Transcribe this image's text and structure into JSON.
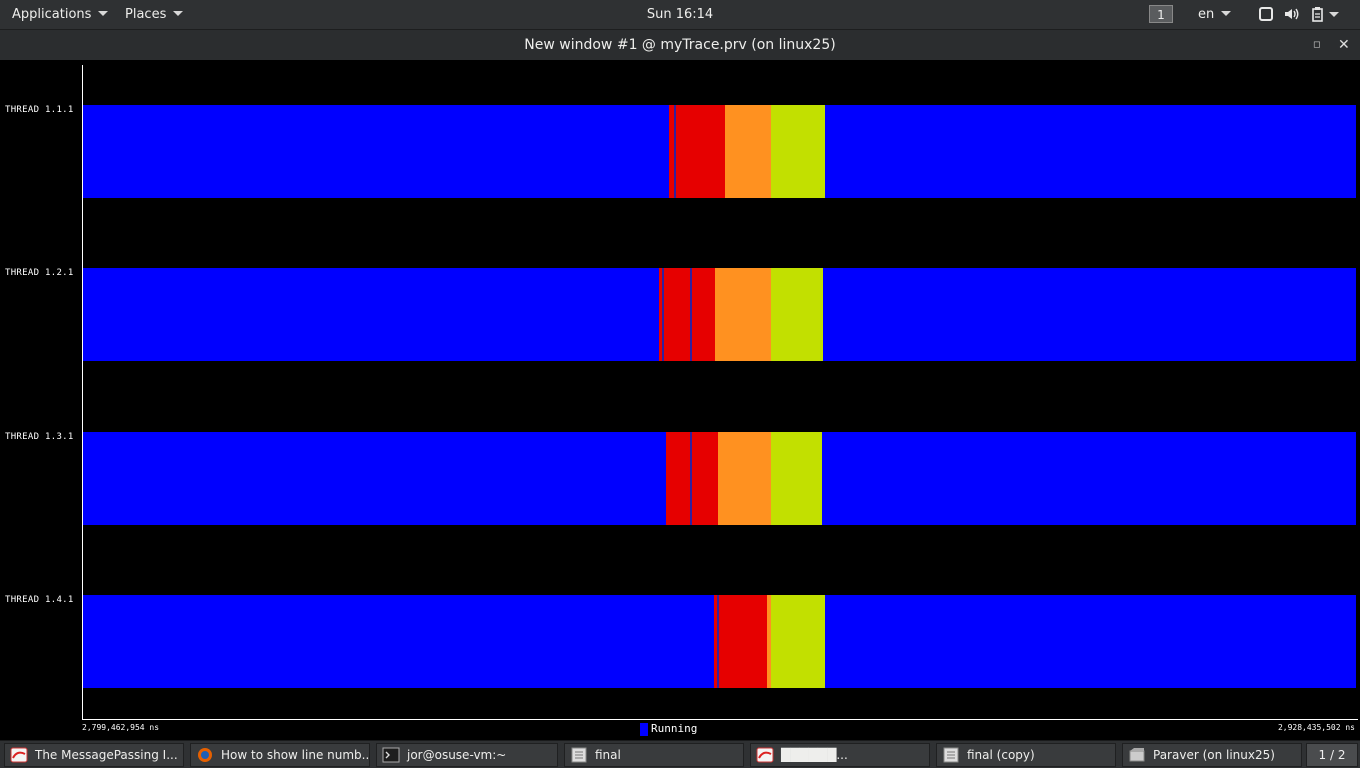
{
  "top_panel": {
    "applications_label": "Applications",
    "places_label": "Places",
    "clock": "Sun 16:14",
    "workspace_number": "1",
    "language": "en"
  },
  "window": {
    "title": "New window #1 @ myTrace.prv (on linux25)"
  },
  "timeline": {
    "threads": [
      "THREAD 1.1.1",
      "THREAD 1.2.1",
      "THREAD 1.3.1",
      "THREAD 1.4.1"
    ],
    "start_time": "2,799,462,954 ns",
    "end_time": "2,928,435,502 ns",
    "legend_label": "Running",
    "legend_color": "#0000ff",
    "state_colors": {
      "running": "#0000ff",
      "red": "#e60000",
      "orange": "#ff9120",
      "yellow_green": "#c2e000"
    }
  },
  "taskbar": {
    "tasks": [
      {
        "label": "The MessagePassing I...",
        "icon": "paraver-icon"
      },
      {
        "label": "How to show line numb...",
        "icon": "firefox-icon"
      },
      {
        "label": "jor@osuse-vm:~",
        "icon": "terminal-icon"
      },
      {
        "label": "final",
        "icon": "file-icon"
      },
      {
        "label": "██████...",
        "icon": "paraver-icon"
      },
      {
        "label": "final (copy)",
        "icon": "file-icon"
      },
      {
        "label": "Paraver (on linux25)",
        "icon": "window-icon"
      }
    ],
    "pager": "1 / 2"
  }
}
